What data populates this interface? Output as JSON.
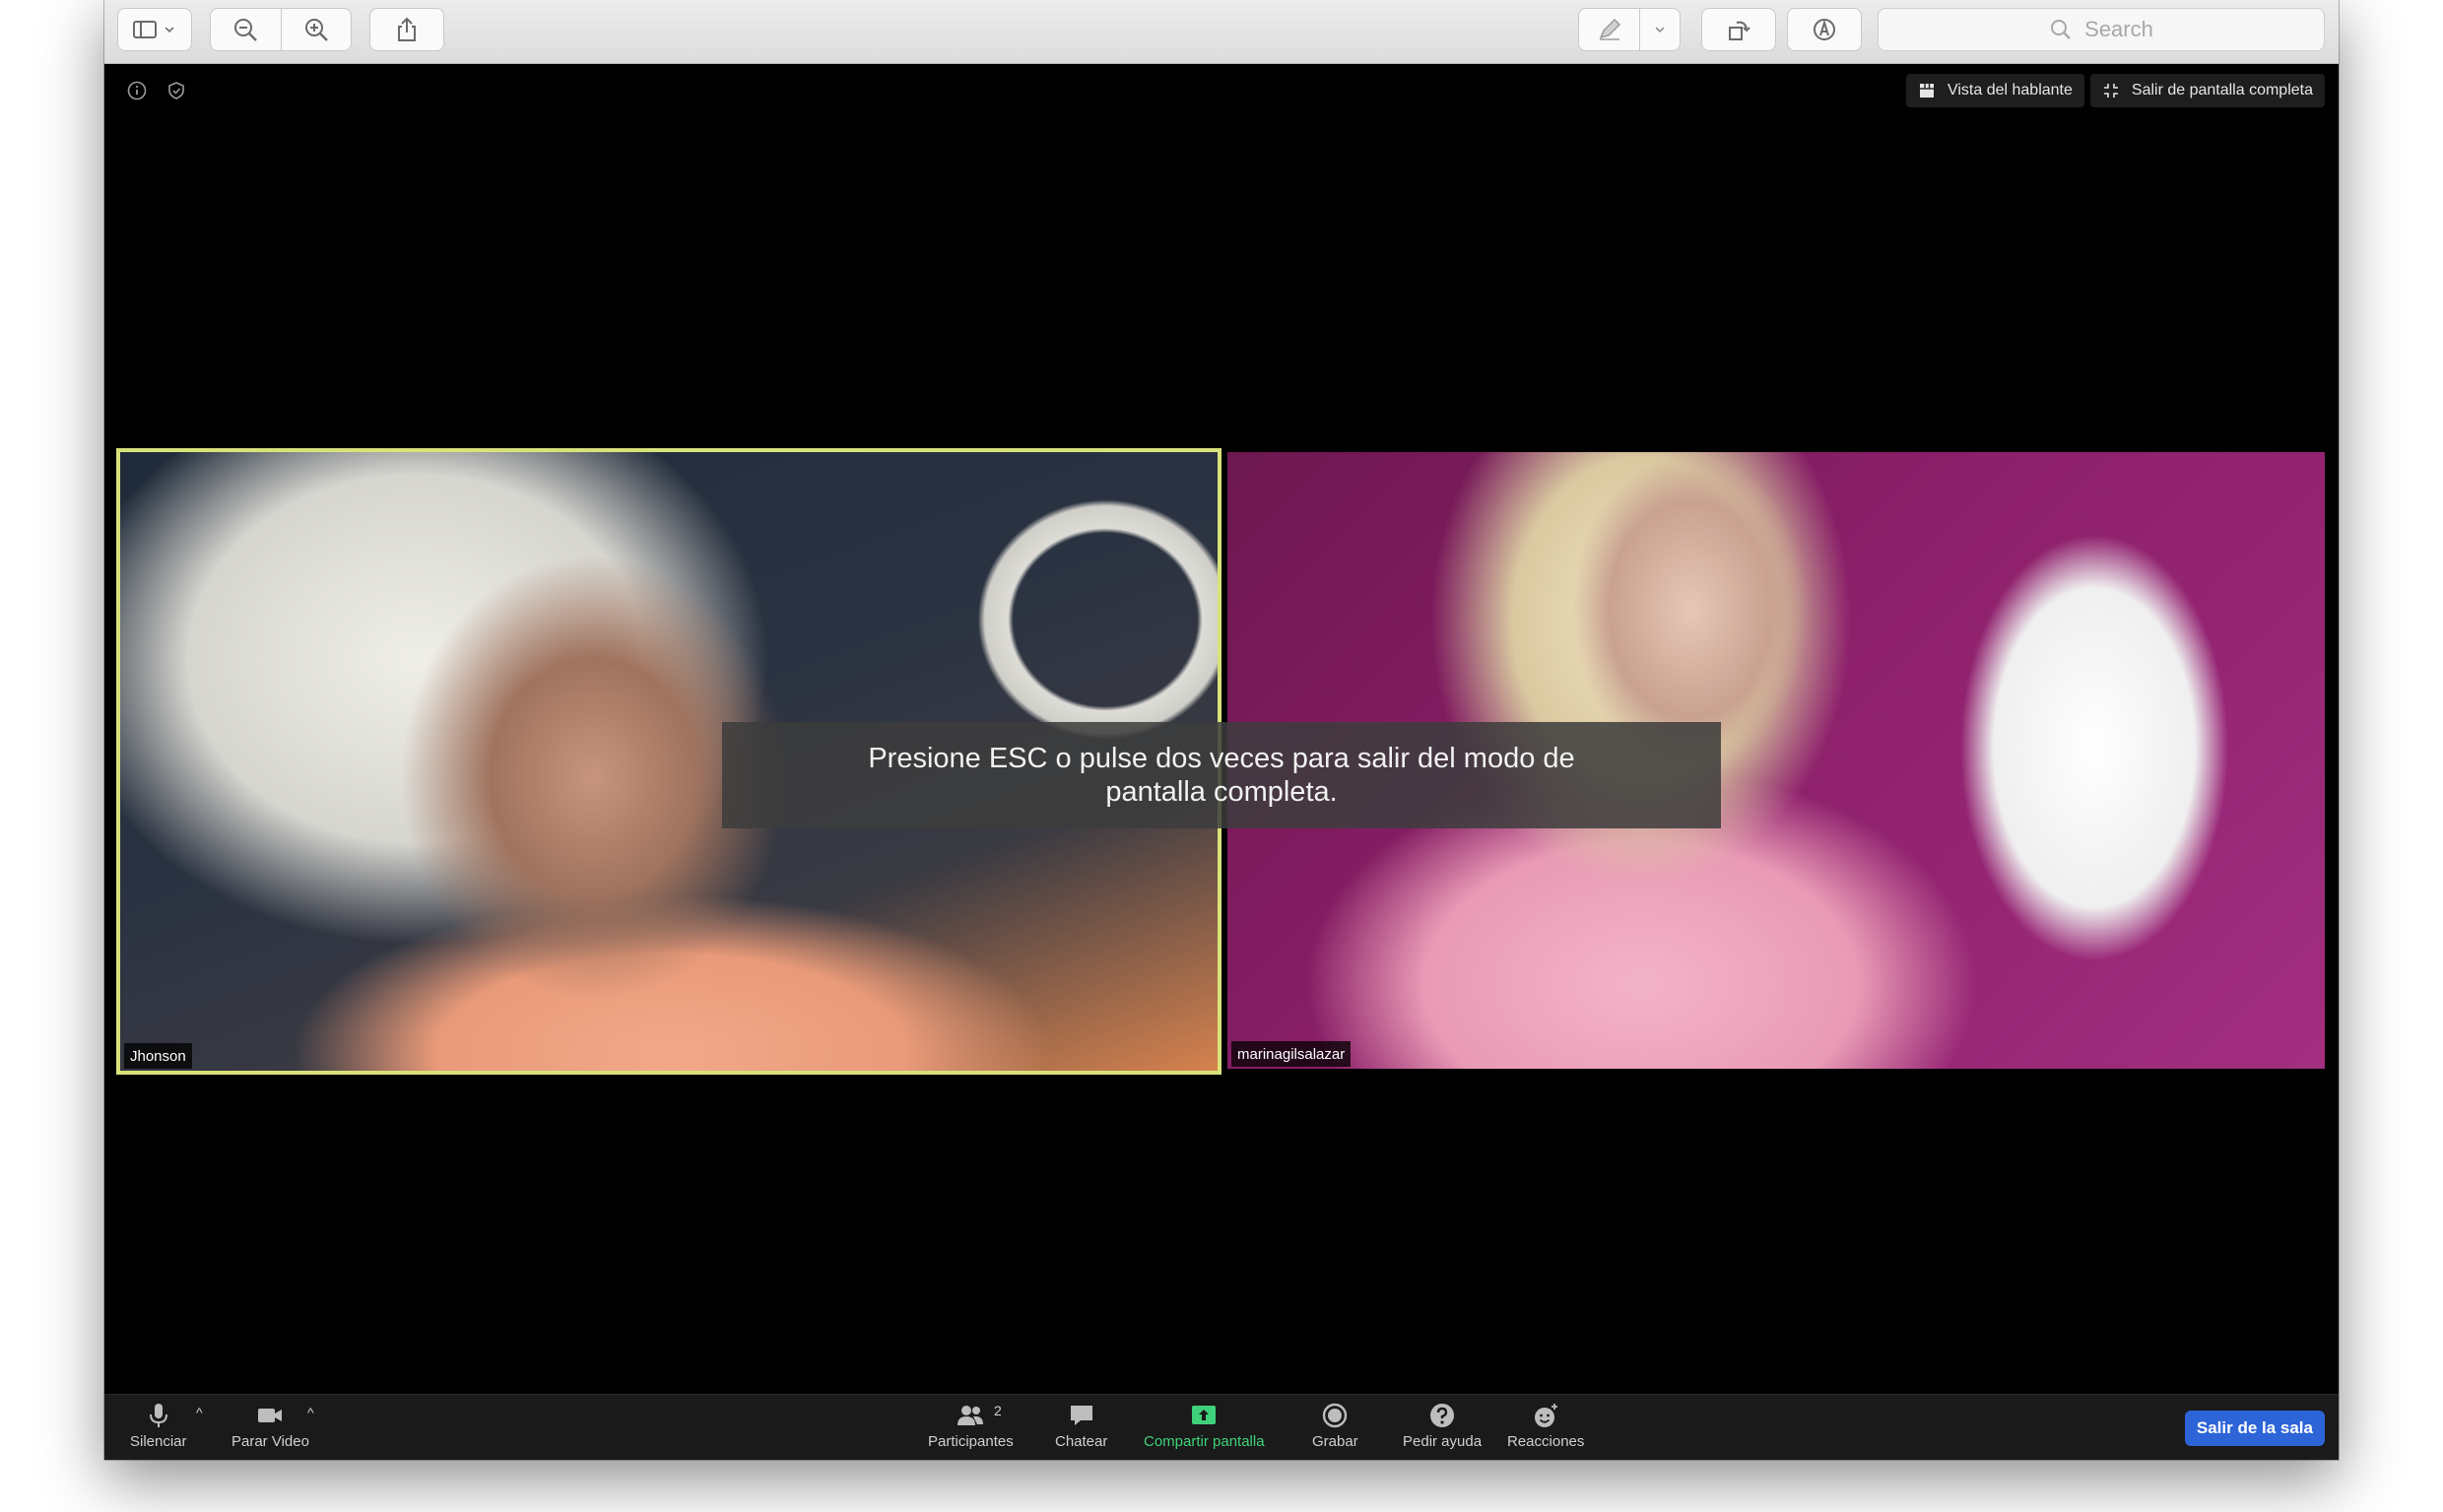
{
  "toolbar": {
    "search_placeholder": "Search",
    "icons": [
      "sidebar-icon",
      "chevron-down-icon",
      "zoom-out-icon",
      "zoom-in-icon",
      "share-icon",
      "highlight-pen-icon",
      "rotate-icon",
      "markup-icon",
      "search-icon"
    ]
  },
  "top_bar": {
    "speaker_view": "Vista del hablante",
    "exit_fullscreen": "Salir de pantalla completa"
  },
  "participants": [
    {
      "name": "Jhonson"
    },
    {
      "name": "marinagilsalazar"
    }
  ],
  "banner": {
    "text": "Presione ESC o pulse dos veces para salir del modo de pantalla completa."
  },
  "controls": {
    "mute": "Silenciar",
    "stop_video": "Parar Video",
    "participants": "Participantes",
    "participants_count": "2",
    "chat": "Chatear",
    "share_screen": "Compartir pantalla",
    "record": "Grabar",
    "ask_help": "Pedir ayuda",
    "reactions": "Reacciones",
    "leave": "Salir de la sala"
  },
  "colors": {
    "active_speaker_border": "#d8e27a",
    "share_green": "#3fd27a",
    "leave_blue": "#2d64d8"
  }
}
